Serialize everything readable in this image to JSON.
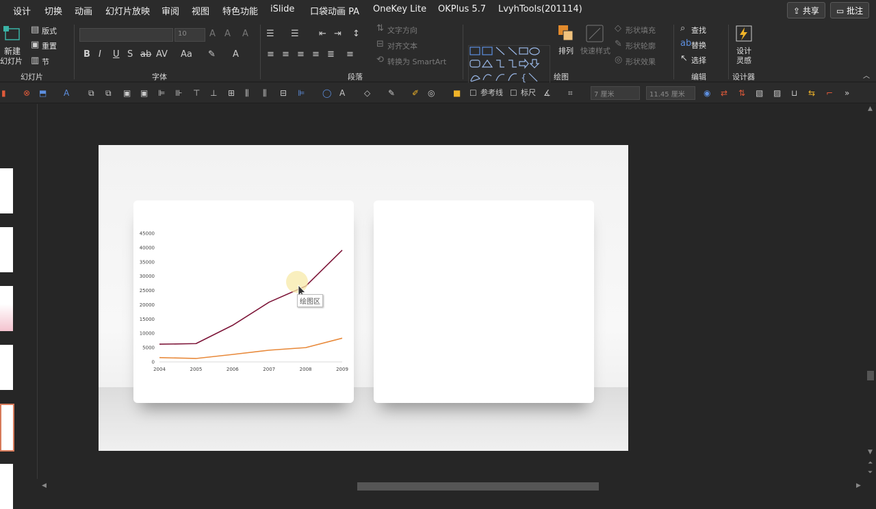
{
  "menubar": {
    "items": [
      "设计",
      "切换",
      "动画",
      "幻灯片放映",
      "审阅",
      "视图",
      "特色功能",
      "iSlide",
      "口袋动画 PA",
      "OneKey Lite",
      "OKPlus 5.7",
      "LvyhTools(201114)"
    ],
    "share_label": "共享",
    "comment_label": "批注"
  },
  "ribbon": {
    "slides": {
      "new_label_1": "新建",
      "new_label_2": "幻灯片",
      "layout_label": "版式",
      "reset_label": "重置",
      "section_label": "节",
      "group_label": "幻灯片"
    },
    "font": {
      "size_value": "10",
      "group_label": "字体"
    },
    "paragraph": {
      "text_direction": "文字方向",
      "align_text": "对齐文本",
      "smartart": "转换为 SmartArt",
      "group_label": "段落"
    },
    "drawing": {
      "arrange": "排列",
      "quick_styles": "快速样式",
      "shape_fill": "形状填充",
      "shape_outline": "形状轮廓",
      "shape_effects": "形状效果",
      "group_label": "绘图"
    },
    "editing": {
      "find": "查找",
      "replace": "替换",
      "select": "选择",
      "group_label": "编辑"
    },
    "designer": {
      "label_1": "设计",
      "label_2": "灵感",
      "group_label": "设计器"
    }
  },
  "toolbar": {
    "guides_label": "参考线",
    "ruler_label": "标尺",
    "height_value": "7 厘米",
    "width_value": "11.45 厘米"
  },
  "tooltip": "绘图区",
  "chart_data": {
    "type": "line",
    "x": [
      "2004",
      "2005",
      "2006",
      "2007",
      "2008",
      "2009"
    ],
    "ylim": [
      0,
      45000
    ],
    "yticks": [
      "0",
      "5000",
      "10000",
      "15000",
      "20000",
      "25000",
      "30000",
      "35000",
      "40000",
      "45000"
    ],
    "series": [
      {
        "color": "#7d1538",
        "values": [
          6200,
          6400,
          12800,
          20900,
          26500,
          39100
        ]
      },
      {
        "color": "#e8893a",
        "values": [
          1500,
          1200,
          2600,
          4100,
          5000,
          8300
        ]
      }
    ]
  }
}
